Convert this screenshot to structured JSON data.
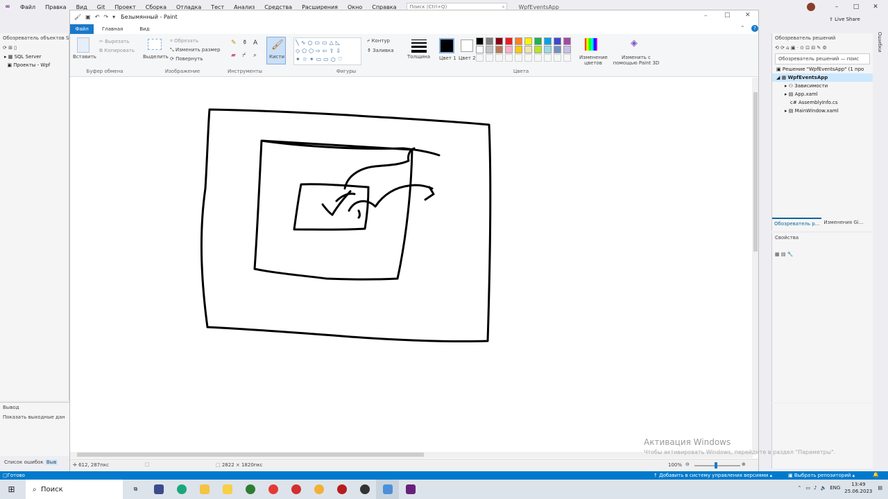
{
  "vs": {
    "menu": [
      "Файл",
      "Правка",
      "Вид",
      "Git",
      "Проект",
      "Сборка",
      "Отладка",
      "Тест",
      "Анализ",
      "Средства",
      "Расширения",
      "Окно",
      "Справка"
    ],
    "search_placeholder": "Поиск (Ctrl+Q)",
    "solution_title": "WpfEventsApp",
    "live_share": "Live Share",
    "left_panel_title": "Обозреватель объектов S",
    "left_tree": [
      "SQL Server",
      "Проекты - Wpf"
    ],
    "output_title": "Вывод",
    "output_text": "Показать выходные дан",
    "error_list_tab": "Список ошибок",
    "error_list_tab2": "Выв",
    "solution_explorer_title": "Обозреватель решений",
    "solution_search": "Обозреватель решений — поис",
    "solution_tree": [
      "Решение \"WpfEventsApp\" (1 про",
      "WpfEventsApp",
      "Зависимости",
      "App.xaml",
      "AssemblyInfo.cs",
      "MainWindow.xaml"
    ],
    "right_tabs": [
      "Обозреватель р...",
      "Изменения Gi..."
    ],
    "properties_title": "Свойства",
    "right_strip_label": "Ошибки"
  },
  "paint": {
    "title": "Безымянный - Paint",
    "tabs": {
      "file": "Файл",
      "home": "Главная",
      "view": "Вид"
    },
    "clipboard": {
      "paste": "Вставить",
      "cut": "Вырезать",
      "copy": "Копировать",
      "label": "Буфер обмена"
    },
    "image": {
      "select": "Выделить",
      "crop": "Обрезать",
      "resize": "Изменить размер",
      "rotate": "Повернуть",
      "label": "Изображение"
    },
    "tools": {
      "label": "Инструменты",
      "brushes": "Кисти"
    },
    "shapes": {
      "outline": "Контур",
      "fill": "Заливка",
      "label": "Фигуры"
    },
    "thickness": "Толщина",
    "color1": "Цвет 1",
    "color2": "Цвет 2",
    "colors_label": "Цвета",
    "edit_colors": "Изменение цветов",
    "paint3d": "Изменить с помощью Paint 3D",
    "palette": [
      "#000000",
      "#7f7f7f",
      "#880015",
      "#ed1c24",
      "#ff7f27",
      "#fff200",
      "#22b14c",
      "#00a2e8",
      "#3f48cc",
      "#a349a4",
      "#ffffff",
      "#c3c3c3",
      "#b97a57",
      "#ffaec9",
      "#ffc90e",
      "#efe4b0",
      "#b5e61d",
      "#99d9ea",
      "#7092be",
      "#c8bfe7"
    ],
    "status": {
      "cursor": "612, 287пкс",
      "size": "2822 × 1820пкс",
      "zoom": "100%"
    }
  },
  "watermark": {
    "line1": "Активация Windows",
    "line2": "Чтобы активировать Windows, перейдите в раздел \"Параметры\"."
  },
  "vs_status": {
    "ready": "Готово",
    "source_control": "Добавить в систему управления версиями",
    "repo": "Выбрать репозиторий"
  },
  "taskbar": {
    "search": "Поиск",
    "lang": "ENG",
    "time": "13:49",
    "date": "25.06.2023"
  }
}
